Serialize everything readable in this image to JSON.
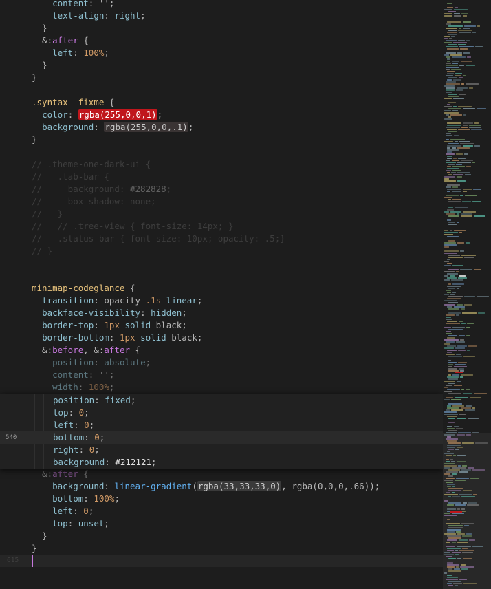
{
  "editor": {
    "lines": [
      {
        "n": "",
        "dim": false,
        "t": [
          [
            "    ",
            "pun"
          ],
          [
            "content",
            "prop"
          ],
          [
            ": '';",
            "pun"
          ]
        ]
      },
      {
        "n": "",
        "dim": false,
        "t": [
          [
            "    ",
            "pun"
          ],
          [
            "text-align",
            "prop"
          ],
          [
            ": ",
            "pun"
          ],
          [
            "right",
            "prop"
          ],
          [
            ";",
            "pun"
          ]
        ]
      },
      {
        "n": "",
        "dim": false,
        "t": [
          [
            "  }",
            "pun"
          ]
        ]
      },
      {
        "n": "",
        "dim": false,
        "t": [
          [
            "  &:",
            "pun"
          ],
          [
            "after",
            "kw"
          ],
          [
            " {",
            "pun"
          ]
        ]
      },
      {
        "n": "",
        "dim": false,
        "t": [
          [
            "    ",
            "pun"
          ],
          [
            "left",
            "prop"
          ],
          [
            ": ",
            "pun"
          ],
          [
            "100%",
            "num"
          ],
          [
            ";",
            "pun"
          ]
        ]
      },
      {
        "n": "",
        "dim": false,
        "t": [
          [
            "  }",
            "pun"
          ]
        ]
      },
      {
        "n": "",
        "dim": false,
        "t": [
          [
            "}",
            "pun"
          ]
        ]
      },
      {
        "n": "",
        "dim": false,
        "t": []
      },
      {
        "n": "",
        "dim": false,
        "t": [
          [
            ".syntax--fixme",
            "sel"
          ],
          [
            " {",
            "pun"
          ]
        ]
      },
      {
        "n": "",
        "dim": false,
        "t": [
          [
            "  ",
            "pun"
          ],
          [
            "color",
            "prop"
          ],
          [
            ": ",
            "pun"
          ],
          [
            "rgba(255,0,0,1)",
            "sw-red"
          ],
          [
            ";",
            "pun"
          ]
        ]
      },
      {
        "n": "",
        "dim": false,
        "t": [
          [
            "  ",
            "pun"
          ],
          [
            "background",
            "prop"
          ],
          [
            ": ",
            "pun"
          ],
          [
            "rgba(255,0,0,.1)",
            "sw-dark"
          ],
          [
            ";",
            "pun"
          ]
        ]
      },
      {
        "n": "",
        "dim": false,
        "t": [
          [
            "}",
            "pun"
          ]
        ]
      },
      {
        "n": "",
        "dim": false,
        "t": []
      },
      {
        "n": "",
        "dim": false,
        "t": [
          [
            "// .theme-one-dark-ui {",
            "cmt"
          ]
        ]
      },
      {
        "n": "",
        "dim": false,
        "t": [
          [
            "//   .tab-bar {",
            "cmt"
          ]
        ]
      },
      {
        "n": "",
        "dim": false,
        "t": [
          [
            "//     background: ",
            "cmt"
          ],
          [
            "#282828",
            "hexc"
          ],
          [
            ";",
            "cmt"
          ]
        ]
      },
      {
        "n": "",
        "dim": false,
        "t": [
          [
            "//     box-shadow: none;",
            "cmt"
          ]
        ]
      },
      {
        "n": "",
        "dim": false,
        "t": [
          [
            "//   }",
            "cmt"
          ]
        ]
      },
      {
        "n": "",
        "dim": false,
        "t": [
          [
            "//   // .tree-view { font-size: 14px; }",
            "cmt"
          ]
        ]
      },
      {
        "n": "",
        "dim": false,
        "t": [
          [
            "//   .status-bar { font-size: 10px; opacity: .5;}",
            "cmt"
          ]
        ]
      },
      {
        "n": "",
        "dim": false,
        "t": [
          [
            "// }",
            "cmt"
          ]
        ]
      },
      {
        "n": "",
        "dim": false,
        "t": []
      },
      {
        "n": "",
        "dim": false,
        "t": []
      },
      {
        "n": "",
        "dim": false,
        "t": [
          [
            "minimap-codeglance",
            "sel"
          ],
          [
            " {",
            "pun"
          ]
        ]
      },
      {
        "n": "",
        "dim": false,
        "t": [
          [
            "  ",
            "pun"
          ],
          [
            "transition",
            "prop"
          ],
          [
            ": opacity ",
            "pun"
          ],
          [
            ".1s",
            "num"
          ],
          [
            " ",
            "pun"
          ],
          [
            "linear",
            "prop"
          ],
          [
            ";",
            "pun"
          ]
        ]
      },
      {
        "n": "",
        "dim": false,
        "t": [
          [
            "  ",
            "pun"
          ],
          [
            "backface-visibility",
            "prop"
          ],
          [
            ": ",
            "pun"
          ],
          [
            "hidden",
            "prop"
          ],
          [
            ";",
            "pun"
          ]
        ]
      },
      {
        "n": "",
        "dim": false,
        "t": [
          [
            "  ",
            "pun"
          ],
          [
            "border-top",
            "prop"
          ],
          [
            ": ",
            "pun"
          ],
          [
            "1px",
            "num"
          ],
          [
            " ",
            "pun"
          ],
          [
            "solid",
            "prop"
          ],
          [
            " black;",
            "pun"
          ]
        ]
      },
      {
        "n": "",
        "dim": false,
        "t": [
          [
            "  ",
            "pun"
          ],
          [
            "border-bottom",
            "prop"
          ],
          [
            ": ",
            "pun"
          ],
          [
            "1px",
            "num"
          ],
          [
            " ",
            "pun"
          ],
          [
            "solid",
            "prop"
          ],
          [
            " black;",
            "pun"
          ]
        ]
      },
      {
        "n": "",
        "dim": false,
        "t": [
          [
            "  &:",
            "pun"
          ],
          [
            "before",
            "kw"
          ],
          [
            ", &:",
            "pun"
          ],
          [
            "after",
            "kw"
          ],
          [
            " {",
            "pun"
          ]
        ]
      },
      {
        "n": "",
        "dim": true,
        "t": [
          [
            "    ",
            "pun"
          ],
          [
            "position",
            "prop"
          ],
          [
            ": ",
            "pun"
          ],
          [
            "absolute",
            "prop"
          ],
          [
            ";",
            "pun"
          ]
        ]
      },
      {
        "n": "",
        "dim": true,
        "t": [
          [
            "    ",
            "pun"
          ],
          [
            "content",
            "prop"
          ],
          [
            ": '';",
            "pun"
          ]
        ]
      },
      {
        "n": "",
        "dim": true,
        "t": [
          [
            "    ",
            "pun"
          ],
          [
            "width",
            "prop"
          ],
          [
            ": ",
            "pun"
          ],
          [
            "100%",
            "num"
          ],
          [
            ";",
            "pun"
          ]
        ]
      },
      {
        "n": "",
        "dim": true,
        "t": []
      },
      {
        "n": "",
        "dim": true,
        "t": []
      },
      {
        "n": "",
        "dim": true,
        "t": []
      },
      {
        "n": "",
        "dim": true,
        "t": []
      },
      {
        "n": "",
        "dim": true,
        "t": []
      },
      {
        "n": "",
        "dim": true,
        "t": []
      },
      {
        "n": "",
        "dim": true,
        "t": [
          [
            "  &:",
            "pun"
          ],
          [
            "after",
            "kw"
          ],
          [
            " {",
            "pun"
          ]
        ]
      },
      {
        "n": "",
        "dim": false,
        "t": [
          [
            "    ",
            "pun"
          ],
          [
            "background",
            "prop"
          ],
          [
            ": ",
            "pun"
          ],
          [
            "linear-gradient",
            "fn"
          ],
          [
            "(",
            "pun"
          ],
          [
            "rgba(33,33,33,0)",
            "sw-gray"
          ],
          [
            ", rgba(0,0,0,.66));",
            "pun"
          ]
        ]
      },
      {
        "n": "",
        "dim": false,
        "t": [
          [
            "    ",
            "pun"
          ],
          [
            "bottom",
            "prop"
          ],
          [
            ": ",
            "pun"
          ],
          [
            "100%",
            "num"
          ],
          [
            ";",
            "pun"
          ]
        ]
      },
      {
        "n": "",
        "dim": false,
        "t": [
          [
            "    ",
            "pun"
          ],
          [
            "left",
            "prop"
          ],
          [
            ": ",
            "pun"
          ],
          [
            "0",
            "num"
          ],
          [
            ";",
            "pun"
          ]
        ]
      },
      {
        "n": "",
        "dim": false,
        "t": [
          [
            "    ",
            "pun"
          ],
          [
            "top",
            "prop"
          ],
          [
            ": ",
            "pun"
          ],
          [
            "unset",
            "prop"
          ],
          [
            ";",
            "pun"
          ]
        ]
      },
      {
        "n": "",
        "dim": false,
        "t": [
          [
            "  }",
            "pun"
          ]
        ]
      },
      {
        "n": "",
        "dim": false,
        "t": [
          [
            "}",
            "pun"
          ]
        ]
      },
      {
        "n": "615",
        "dim": false,
        "t": []
      }
    ],
    "cursor_line": 45
  },
  "glance": {
    "lines": [
      {
        "n": "",
        "hl": false,
        "t": [
          [
            "position",
            "prop"
          ],
          [
            ": ",
            "pun"
          ],
          [
            "fixed",
            "prop"
          ],
          [
            ";",
            "pun"
          ]
        ]
      },
      {
        "n": "",
        "hl": false,
        "t": [
          [
            "top",
            "prop"
          ],
          [
            ": ",
            "pun"
          ],
          [
            "0",
            "num"
          ],
          [
            ";",
            "pun"
          ]
        ]
      },
      {
        "n": "",
        "hl": false,
        "t": [
          [
            "left",
            "prop"
          ],
          [
            ": ",
            "pun"
          ],
          [
            "0",
            "num"
          ],
          [
            ";",
            "pun"
          ]
        ]
      },
      {
        "n": "540",
        "hl": true,
        "t": [
          [
            "bottom",
            "prop"
          ],
          [
            ": ",
            "pun"
          ],
          [
            "0",
            "num"
          ],
          [
            ";",
            "pun"
          ]
        ]
      },
      {
        "n": "",
        "hl": false,
        "t": [
          [
            "right",
            "prop"
          ],
          [
            ": ",
            "pun"
          ],
          [
            "0",
            "num"
          ],
          [
            ";",
            "pun"
          ]
        ]
      },
      {
        "n": "",
        "hl": false,
        "t": [
          [
            "background",
            "prop"
          ],
          [
            ": ",
            "pun"
          ],
          [
            "#212121",
            "hex"
          ],
          [
            ";",
            "pun"
          ]
        ]
      }
    ]
  },
  "colors": {
    "background": "#1d1d1d",
    "glance_background": "#212121",
    "swatch_red": "#c0161c",
    "swatch_dark": "#3a3434",
    "swatch_gray": "#3a3a3a",
    "cursor_line": "#262626"
  }
}
